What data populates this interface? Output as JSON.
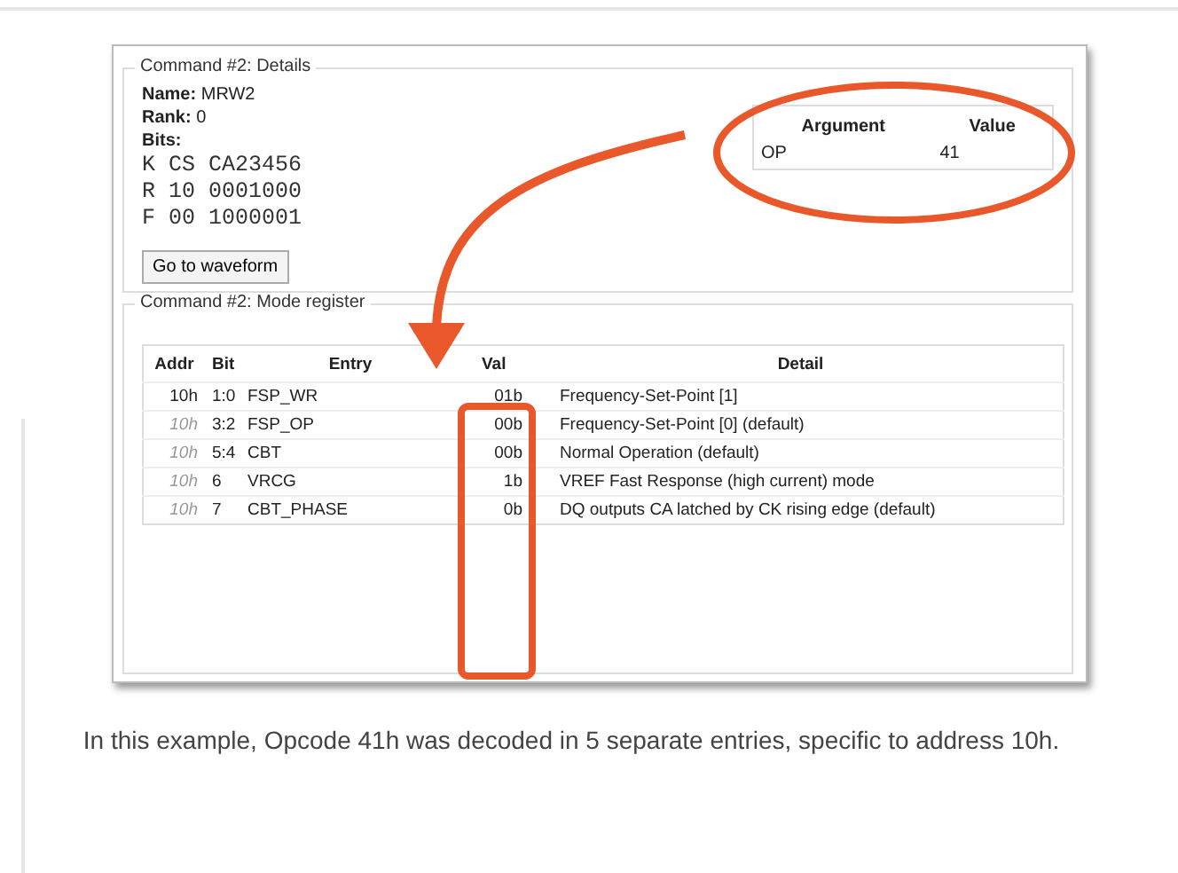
{
  "details": {
    "title": "Command #2: Details",
    "name_label": "Name:",
    "name": "MRW2",
    "rank_label": "Rank:",
    "rank": "0",
    "bits_label": "Bits:",
    "bits": [
      "K CS CA23456",
      "R 10 0001000",
      "F 00 1000001"
    ],
    "arguments": {
      "columns": [
        "Argument",
        "Value"
      ],
      "rows": [
        {
          "argument": "OP",
          "value": "41"
        }
      ]
    },
    "button": "Go to waveform"
  },
  "mode_register": {
    "title": "Command #2: Mode register",
    "columns": [
      "Addr",
      "Bit",
      "Entry",
      "Val",
      "Detail"
    ],
    "rows": [
      {
        "addr": "10h",
        "greyed": false,
        "bit": "1:0",
        "entry": "FSP_WR",
        "val": "01b",
        "detail": "Frequency-Set-Point [1]"
      },
      {
        "addr": "10h",
        "greyed": true,
        "bit": "3:2",
        "entry": "FSP_OP",
        "val": "00b",
        "detail": "Frequency-Set-Point [0] (default)"
      },
      {
        "addr": "10h",
        "greyed": true,
        "bit": "5:4",
        "entry": "CBT",
        "val": "00b",
        "detail": "Normal Operation (default)"
      },
      {
        "addr": "10h",
        "greyed": true,
        "bit": "6",
        "entry": "VRCG",
        "val": "1b",
        "detail": "VREF Fast Response (high current) mode"
      },
      {
        "addr": "10h",
        "greyed": true,
        "bit": "7",
        "entry": "CBT_PHASE",
        "val": "0b",
        "detail": "DQ outputs CA latched by CK rising edge (default)"
      }
    ]
  },
  "caption": "In this example, Opcode 41h was decoded in 5 separate entries, specific to address 10h."
}
